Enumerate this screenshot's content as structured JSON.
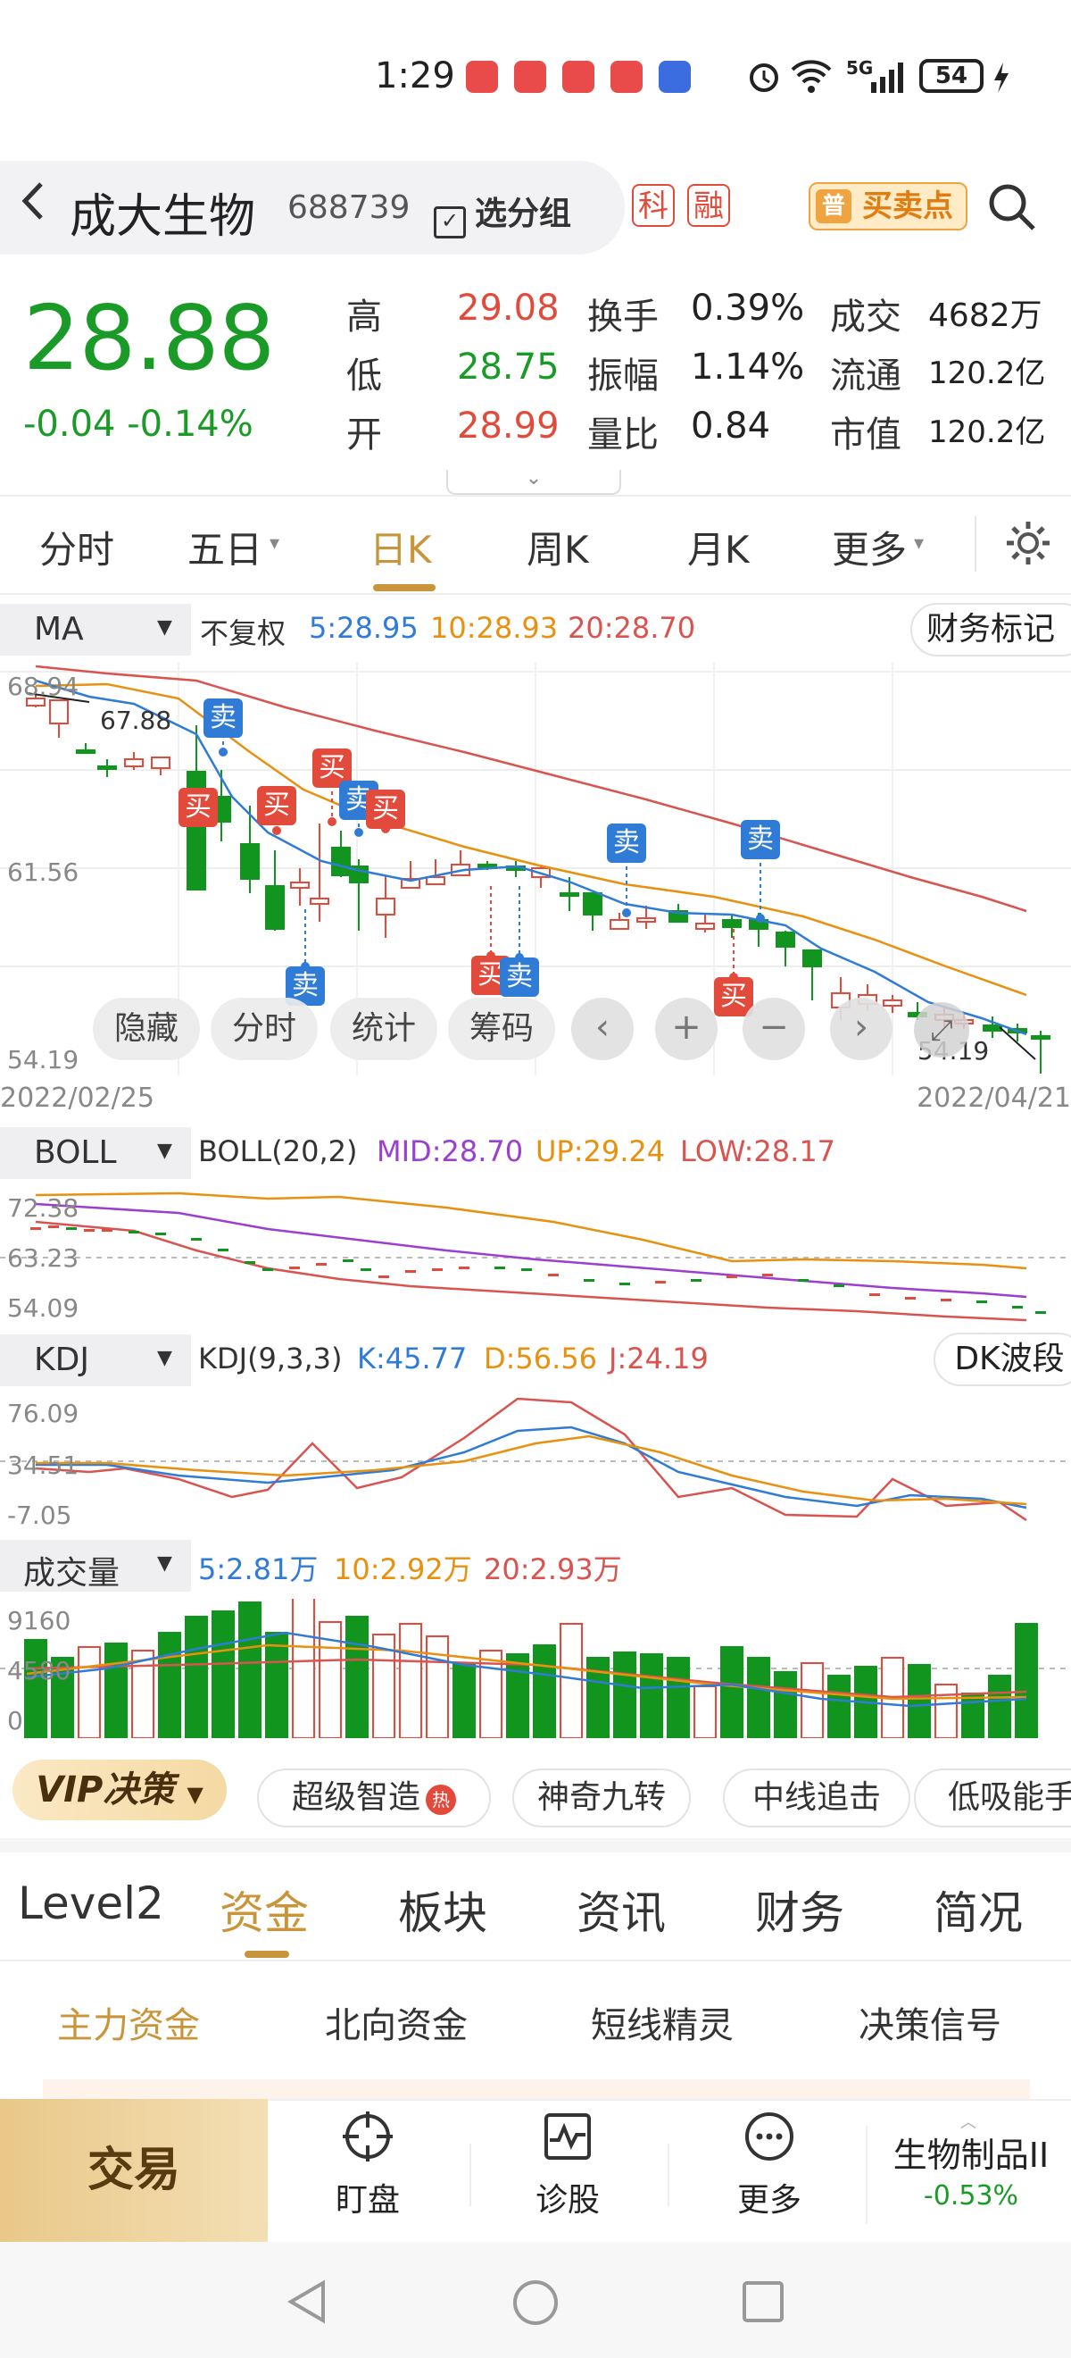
{
  "status_bar": {
    "time": "1:29",
    "battery": "54",
    "signal": "5G"
  },
  "header": {
    "back_icon": "chevron-left-icon",
    "stock_name": "成大生物",
    "stock_code": "688739",
    "group_button": "选分组",
    "tag_ke": "科",
    "tag_rong": "融",
    "buy_point_badge": "普",
    "buy_point_label": "买卖点",
    "search_icon": "search-icon"
  },
  "quote": {
    "price": "28.88",
    "change": "-0.04",
    "change_pct": "-0.14%",
    "rows": [
      {
        "l1": "高",
        "v1": "29.08",
        "c1": "#e24b3b",
        "l2": "换手",
        "v2": "0.39%",
        "l3": "成交",
        "v3": "4682万"
      },
      {
        "l1": "低",
        "v1": "28.75",
        "c1": "#1a9a27",
        "l2": "振幅",
        "v2": "1.14%",
        "l3": "流通",
        "v3": "120.2亿"
      },
      {
        "l1": "开",
        "v1": "28.99",
        "c1": "#e24b3b",
        "l2": "量比",
        "v2": "0.84",
        "l3": "市值",
        "v3": "120.2亿"
      }
    ]
  },
  "period_tabs": [
    "分时",
    "五日",
    "日K",
    "周K",
    "月K",
    "更多"
  ],
  "active_period": "日K",
  "ma_bar": {
    "name": "MA",
    "adjust": "不复权",
    "ma5": "5:28.95",
    "ma10": "10:28.93",
    "ma20": "20:28.70",
    "finance_mark": "财务标记"
  },
  "kline": {
    "y_top": "68.94",
    "y_mid": "61.56",
    "y_bottom": "54.19",
    "hi_label": "67.88",
    "low_label": "54.19",
    "date_start": "2022/02/25",
    "date_end": "2022/04/21",
    "buttons": [
      "隐藏",
      "分时",
      "统计",
      "筹码"
    ],
    "buy": "买",
    "sell": "卖"
  },
  "boll_bar": {
    "name": "BOLL",
    "title": "BOLL(20,2)",
    "mid": "MID:28.70",
    "up": "UP:29.24",
    "low": "LOW:28.17",
    "y_top": "72.38",
    "y_mid": "63.23",
    "y_bottom": "54.09"
  },
  "kdj_bar": {
    "name": "KDJ",
    "title": "KDJ(9,3,3)",
    "k": "K:45.77",
    "d": "D:56.56",
    "j": "J:24.19",
    "dk_button": "DK波段",
    "y_top": "76.09",
    "y_mid": "34.51",
    "y_bottom": "-7.05"
  },
  "vol_bar": {
    "name": "成交量",
    "v5": "5:2.81万",
    "v10": "10:2.92万",
    "v20": "20:2.93万",
    "y_top": "9160",
    "y_mid": "4580",
    "y_bottom": "0"
  },
  "decision": {
    "vip": "VIP决策",
    "pills": [
      "超级智造",
      "神奇九转",
      "中线追击",
      "低吸能手"
    ],
    "hot": "热"
  },
  "detail_tabs": [
    "Level2",
    "资金",
    "板块",
    "资讯",
    "财务",
    "简况"
  ],
  "active_detail": "资金",
  "sub_tabs": [
    "主力资金",
    "北向资金",
    "短线精灵",
    "决策信号"
  ],
  "bottom": {
    "trade": "交易",
    "nav": [
      {
        "icon": "crosshair-icon",
        "label": "盯盘"
      },
      {
        "icon": "pulse-icon",
        "label": "诊股"
      },
      {
        "icon": "more-dots-icon",
        "label": "更多"
      }
    ],
    "sector_name": "生物制品II",
    "sector_change": "-0.53%"
  }
}
